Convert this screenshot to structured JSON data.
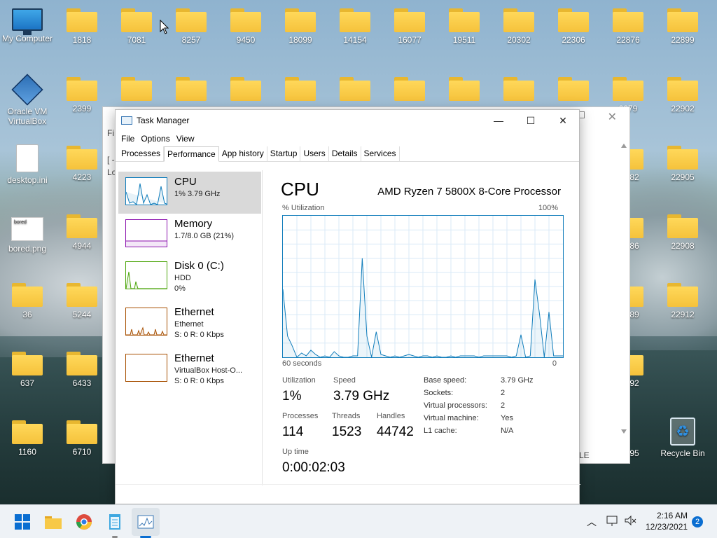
{
  "desktop": {
    "row1": [
      "My Computer",
      "1818",
      "7081",
      "8257",
      "9450",
      "18099",
      "14154",
      "16077",
      "19511",
      "20302",
      "22306",
      "22876",
      "22899"
    ],
    "row2": [
      "2399",
      "2379",
      "22902"
    ],
    "vbox_label": "Oracle VM VirtualBox",
    "desktop_ini": "desktop.ini",
    "col_left": [
      {
        "label": "4223"
      },
      {
        "label": "4944"
      },
      {
        "label": "5244"
      },
      {
        "label": "6433"
      },
      {
        "label": "6710"
      }
    ],
    "bored_png": "bored.png",
    "bored_text": "bored",
    "col0": [
      "36",
      "637",
      "1160"
    ],
    "col_right": [
      "22905",
      "22908",
      "22912"
    ],
    "right_partial": [
      "82",
      "86",
      "89",
      "92",
      "95"
    ],
    "recycle_bin": "Recycle Bin"
  },
  "background_window": {
    "frag1": "Fi",
    "frag2": "[ -",
    "frag3": "Lo",
    "frag4": "LE"
  },
  "task_manager": {
    "title": "Task Manager",
    "menu": [
      "File",
      "Options",
      "View"
    ],
    "tabs": [
      "Processes",
      "Performance",
      "App history",
      "Startup",
      "Users",
      "Details",
      "Services"
    ],
    "active_tab": "Performance",
    "sidebar": [
      {
        "name": "CPU",
        "line2": "1% 3.79 GHz",
        "line3": "",
        "color": "#117dbb"
      },
      {
        "name": "Memory",
        "line2": "1.7/8.0 GB (21%)",
        "line3": "",
        "color": "#8b12ae"
      },
      {
        "name": "Disk 0 (C:)",
        "line2": "HDD",
        "line3": "0%",
        "color": "#4da60c"
      },
      {
        "name": "Ethernet",
        "line2": "Ethernet",
        "line3": "S: 0  R: 0 Kbps",
        "color": "#a74f01"
      },
      {
        "name": "Ethernet",
        "line2": "VirtualBox Host-O...",
        "line3": "S: 0  R: 0 Kbps",
        "color": "#a74f01"
      }
    ],
    "main": {
      "title": "CPU",
      "processor": "AMD Ryzen 7 5800X 8-Core Processor",
      "util_label": "% Utilization",
      "max_label": "100%",
      "time_label": "60 seconds",
      "zero_label": "0",
      "stats": {
        "utilization_label": "Utilization",
        "utilization": "1%",
        "speed_label": "Speed",
        "speed": "3.79 GHz",
        "processes_label": "Processes",
        "processes": "114",
        "threads_label": "Threads",
        "threads": "1523",
        "handles_label": "Handles",
        "handles": "44742",
        "uptime_label": "Up time",
        "uptime": "0:00:02:03"
      },
      "details": [
        {
          "k": "Base speed:",
          "v": "3.79 GHz"
        },
        {
          "k": "Sockets:",
          "v": "2"
        },
        {
          "k": "Virtual processors:",
          "v": "2"
        },
        {
          "k": "Virtual machine:",
          "v": "Yes"
        },
        {
          "k": "L1 cache:",
          "v": "N/A"
        }
      ]
    },
    "cpu_history": [
      48,
      15,
      8,
      0,
      3,
      1,
      5,
      2,
      0,
      1,
      0,
      4,
      1,
      0,
      0,
      1,
      1,
      70,
      15,
      0,
      18,
      2,
      1,
      0,
      1,
      0,
      1,
      2,
      1,
      0,
      1,
      1,
      0,
      1,
      0,
      0,
      1,
      0,
      1,
      1,
      1,
      1,
      0,
      1,
      1,
      1,
      1,
      1,
      1,
      0,
      1,
      16,
      0,
      1,
      55,
      30,
      0,
      32,
      1,
      1,
      1
    ]
  },
  "taskbar": {
    "time": "2:16 AM",
    "date": "12/23/2021",
    "notifications": "2"
  }
}
